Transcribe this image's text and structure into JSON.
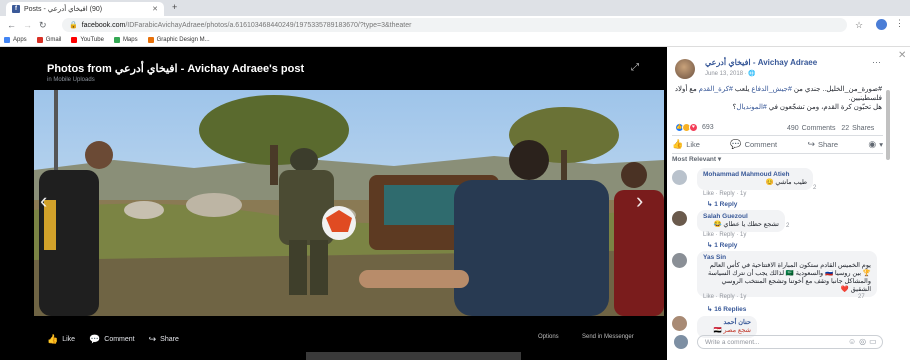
{
  "browser": {
    "tab_title": "(90) افيخاي أدرعي - Posts",
    "new_tab": "+",
    "url_host": "facebook.com",
    "url_path": "/IDFarabicAvichayAdraee/photos/a.616103468440249/1975335789183670/?type=3&theater",
    "bookmarks": [
      {
        "label": "Apps",
        "color": "#4285f4"
      },
      {
        "label": "Gmail",
        "color": "#d93025"
      },
      {
        "label": "YouTube",
        "color": "#ff0000"
      },
      {
        "label": "Maps",
        "color": "#34a853"
      },
      {
        "label": "Graphic Design M...",
        "color": "#e8710a"
      }
    ]
  },
  "theater": {
    "title": "Photos from افيخاي أدرعي - Avichay Adraee's post",
    "subtitle": "in Mobile Uploads",
    "like": "Like",
    "comment": "Comment",
    "share": "Share",
    "options": "Options",
    "send": "Send in Messenger"
  },
  "post": {
    "author": "افيخاي أدرعي - Avichay Adraee",
    "date": "June 13, 2018 ·",
    "text_1": "#صورة_من_الخليل.. جندي من ",
    "hashtag_1": "#جيش_الدفاع",
    "text_2": " يلعب ",
    "hashtag_2": "#كرة_القدم",
    "text_3": " مع أولاد فلسطينيين.",
    "text_4": "هل تحبّون كرة القدم، ومن تشجّعون في ",
    "hashtag_3": "#المونديال",
    "text_5": "؟",
    "reaction_count": "693",
    "comments_count": "490 Comments",
    "shares_count": "22 Shares",
    "like": "Like",
    "comment": "Comment",
    "share": "Share",
    "most_relevant": "Most Relevant ▾"
  },
  "comments": [
    {
      "name": "Mohammad Mahmoud Atieh",
      "text": "طيب ماشي 😊",
      "meta": "Like · Reply · 1y",
      "reply": "↳ 1 Reply",
      "reacts": "2"
    },
    {
      "name": "Salah Guezoul",
      "text": "تشجع حظك يا عطاي 😂",
      "meta": "Like · Reply · 1y",
      "reply": "↳ 1 Reply",
      "reacts": "2"
    },
    {
      "name": "Yas Sin",
      "text": "يوم الخميس القادم ستكون المباراة الافتتاحية في كأس العالم 🏆 بين روسيا 🇷🇺 والسعودية 🇸🇦 لذالك يجب أن نترك السياسة والمشاكل جانبا وتقف مع أخوتنا وتشجع المنتخب الروسي الشقيق ❤️",
      "meta": "Like · Reply · 1y",
      "reply": "↳ 16 Replies",
      "reacts": "27"
    },
    {
      "name": "حنان أحمد",
      "text": "شجع مصر 🇪🇬"
    }
  ],
  "input": {
    "placeholder": "Write a comment..."
  },
  "colors": {
    "accent": "#385898",
    "like_blue": "#2078f4",
    "love_red": "#f33e58",
    "haha_yellow": "#f7b125"
  }
}
